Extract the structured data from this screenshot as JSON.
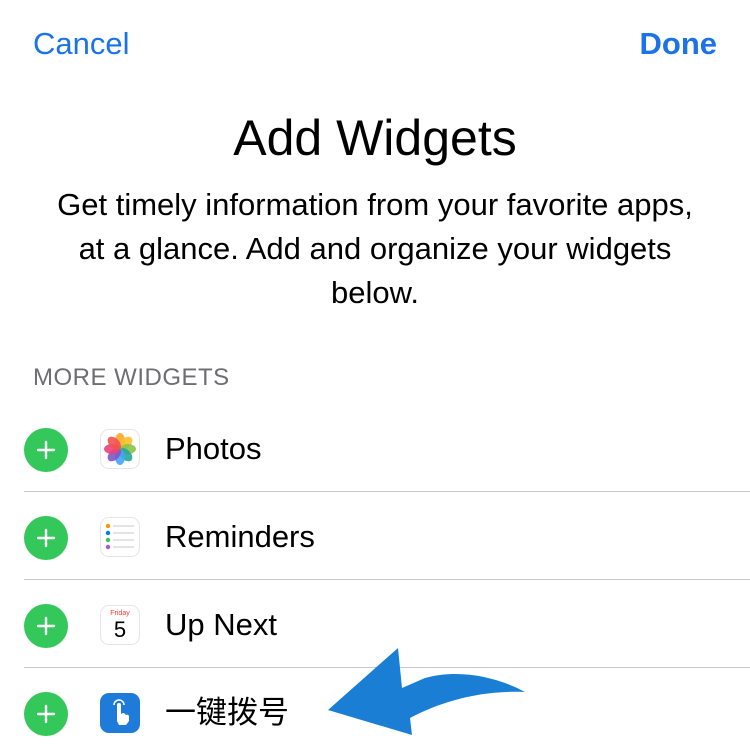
{
  "nav": {
    "cancel_label": "Cancel",
    "done_label": "Done"
  },
  "header": {
    "title": "Add Widgets",
    "description": "Get timely information from your favorite apps, at a glance. Add and organize your widgets below."
  },
  "section": {
    "header": "MORE WIDGETS"
  },
  "widgets": [
    {
      "label": "Photos",
      "icon": "photos-icon"
    },
    {
      "label": "Reminders",
      "icon": "reminders-icon"
    },
    {
      "label": "Up Next",
      "icon": "calendar-icon",
      "icon_day": "Friday",
      "icon_date": "5"
    },
    {
      "label": "一键拨号",
      "icon": "dialer-touch-icon"
    }
  ],
  "colors": {
    "accent": "#1a73e8",
    "add_button": "#34c759",
    "section_header": "#6d6d72",
    "divider": "#c8c7cc",
    "annotation_arrow": "#1a7fd4"
  }
}
